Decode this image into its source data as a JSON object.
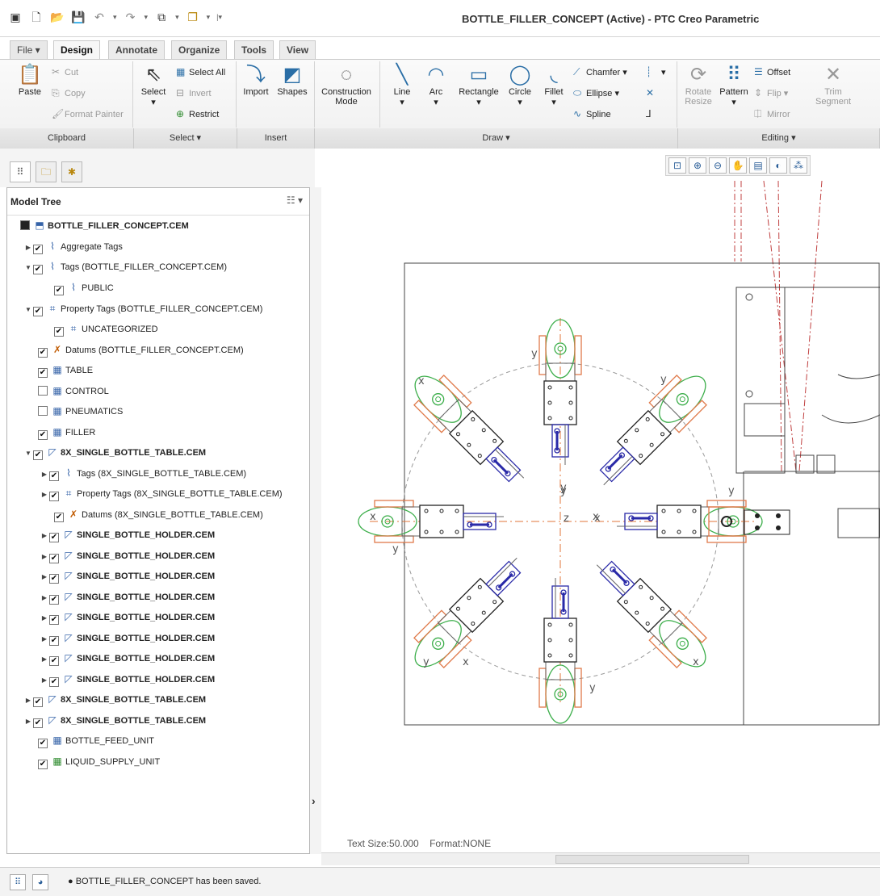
{
  "window": {
    "title": "BOTTLE_FILLER_CONCEPT (Active) - PTC Creo Parametric"
  },
  "ribbon_tabs": [
    "File",
    "Design",
    "Annotate",
    "Organize",
    "Tools",
    "View"
  ],
  "ribbon": {
    "clipboard": {
      "paste": "Paste",
      "cut": "Cut",
      "copy": "Copy",
      "format_painter": "Format Painter",
      "group": "Clipboard"
    },
    "select": {
      "select": "Select",
      "select_all": "Select All",
      "invert": "Invert",
      "restrict": "Restrict",
      "group": "Select"
    },
    "insert": {
      "import": "Import",
      "shapes": "Shapes",
      "group": "Insert"
    },
    "draw": {
      "construction_mode": "Construction Mode",
      "line": "Line",
      "arc": "Arc",
      "rectangle": "Rectangle",
      "circle": "Circle",
      "fillet": "Fillet",
      "chamfer": "Chamfer",
      "ellipse": "Ellipse",
      "spline": "Spline",
      "group": "Draw"
    },
    "editing": {
      "rotate_resize": "Rotate Resize",
      "pattern": "Pattern",
      "offset": "Offset",
      "flip": "Flip",
      "mirror": "Mirror",
      "trim_segment": "Trim Segment",
      "group": "Editing"
    }
  },
  "model_tree": {
    "title": "Model Tree",
    "items": [
      {
        "label": "BOTTLE_FILLER_CONCEPT.CEM",
        "bold": true
      },
      {
        "label": "Aggregate Tags"
      },
      {
        "label": "Tags (BOTTLE_FILLER_CONCEPT.CEM)"
      },
      {
        "label": "PUBLIC"
      },
      {
        "label": "Property Tags (BOTTLE_FILLER_CONCEPT.CEM)"
      },
      {
        "label": "UNCATEGORIZED"
      },
      {
        "label": "Datums (BOTTLE_FILLER_CONCEPT.CEM)"
      },
      {
        "label": "TABLE"
      },
      {
        "label": "CONTROL"
      },
      {
        "label": "PNEUMATICS"
      },
      {
        "label": "FILLER"
      },
      {
        "label": "8X_SINGLE_BOTTLE_TABLE.CEM",
        "bold": true
      },
      {
        "label": "Tags (8X_SINGLE_BOTTLE_TABLE.CEM)"
      },
      {
        "label": "Property Tags (8X_SINGLE_BOTTLE_TABLE.CEM)"
      },
      {
        "label": "Datums (8X_SINGLE_BOTTLE_TABLE.CEM)"
      },
      {
        "label": "SINGLE_BOTTLE_HOLDER.CEM",
        "bold": true
      },
      {
        "label": "SINGLE_BOTTLE_HOLDER.CEM",
        "bold": true
      },
      {
        "label": "SINGLE_BOTTLE_HOLDER.CEM",
        "bold": true
      },
      {
        "label": "SINGLE_BOTTLE_HOLDER.CEM",
        "bold": true
      },
      {
        "label": "SINGLE_BOTTLE_HOLDER.CEM",
        "bold": true
      },
      {
        "label": "SINGLE_BOTTLE_HOLDER.CEM",
        "bold": true
      },
      {
        "label": "SINGLE_BOTTLE_HOLDER.CEM",
        "bold": true
      },
      {
        "label": "SINGLE_BOTTLE_HOLDER.CEM",
        "bold": true
      },
      {
        "label": "8X_SINGLE_BOTTLE_TABLE.CEM",
        "bold": true
      },
      {
        "label": "8X_SINGLE_BOTTLE_TABLE.CEM",
        "bold": true
      },
      {
        "label": "BOTTLE_FEED_UNIT"
      },
      {
        "label": "LIQUID_SUPPLY_UNIT"
      }
    ]
  },
  "graphics": {
    "axis_x": "x",
    "axis_y": "y",
    "axis_z": "z",
    "text_size": "Text Size:50.000",
    "format": "Format:NONE"
  },
  "status": {
    "message": "BOTTLE_FILLER_CONCEPT has been saved."
  }
}
